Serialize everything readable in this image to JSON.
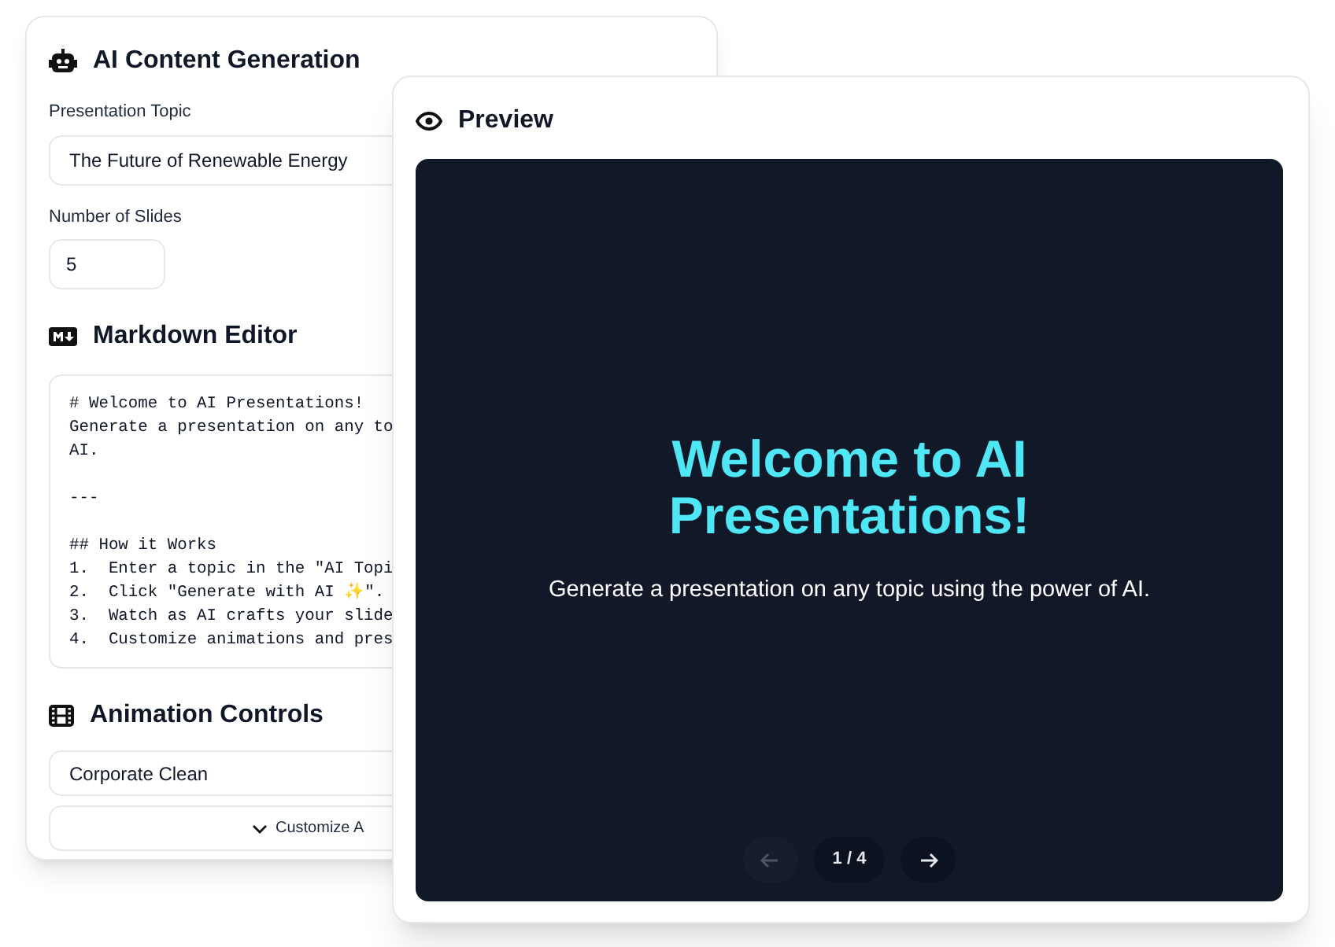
{
  "generation": {
    "title": "AI Content Generation",
    "topic": {
      "label": "Presentation Topic",
      "value": "The Future of Renewable Energy"
    },
    "slides": {
      "label": "Number of Slides",
      "value": "5"
    }
  },
  "editor": {
    "title": "Markdown Editor",
    "blocks": [
      {
        "lines": [
          "# Welcome to AI Presentations!",
          "Generate a presentation on any to",
          "AI."
        ]
      },
      {
        "lines": [
          "---"
        ]
      },
      {
        "lines": [
          "## How it Works",
          "1.  Enter a topic in the \"AI Topi",
          "2.  Click \"Generate with AI ✨\".",
          "3.  Watch as AI crafts your slide",
          "4.  Customize animations and pres"
        ]
      }
    ]
  },
  "animation": {
    "title": "Animation Controls",
    "preset": "Corporate Clean",
    "customize": "Customize A"
  },
  "preview": {
    "title": "Preview",
    "slide_title": "Welcome to AI Presentations!",
    "slide_text": "Generate a presentation on any topic using the power of AI.",
    "counter": "1 / 4",
    "prev_disabled": true,
    "next_disabled": false
  }
}
